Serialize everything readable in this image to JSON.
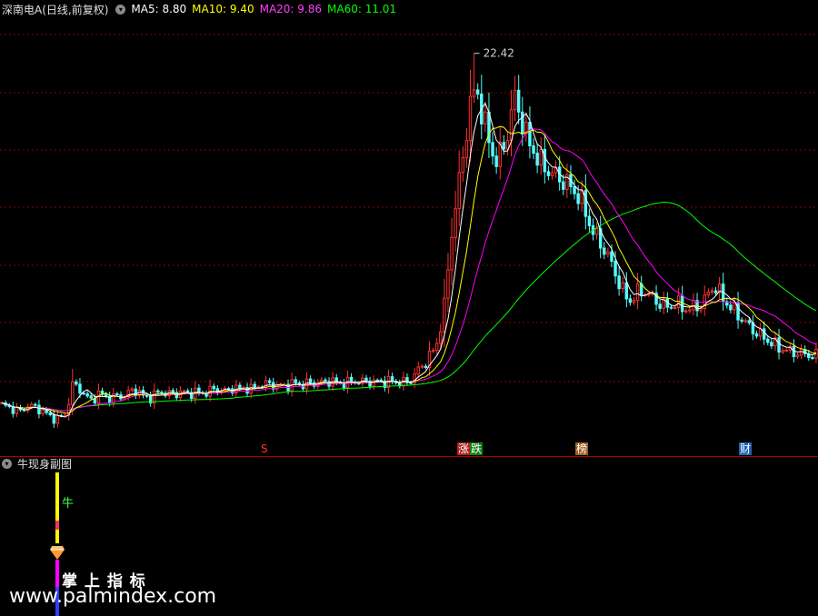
{
  "main_header": {
    "symbol": "深南电A(日线,前复权)",
    "ma5": "MA5: 8.80",
    "ma10": "MA10: 9.40",
    "ma20": "MA20: 9.86",
    "ma60": "MA60: 11.01"
  },
  "sub_header": {
    "title": "牛现身副图"
  },
  "peak_label": "22.42",
  "event_badges": [
    {
      "text": "S",
      "color": "#ff3030"
    },
    {
      "text": "涨",
      "color": "#ff5050"
    },
    {
      "text": "跌",
      "color": "#40e040"
    },
    {
      "text": "榜",
      "color": "#e0a040"
    },
    {
      "text": "财",
      "color": "#40a0ff"
    }
  ],
  "indicator": {
    "bull_label": "牛"
  },
  "watermark": {
    "line1": "掌 上 指 标",
    "line2": "www.palmindex.com"
  },
  "colors": {
    "up": "#ff3030",
    "down": "#54ffff",
    "ma5": "#ffffff",
    "ma10": "#ffff00",
    "ma20": "#ff00ff",
    "ma60": "#00ff00",
    "grid": "#8b0000"
  },
  "chart_data": {
    "type": "candlestick",
    "ylim": [
      5,
      24
    ],
    "peak": 22.42,
    "close_path": [
      6.6,
      6.5,
      6.4,
      6.3,
      6.6,
      6.5,
      6.4,
      6.2,
      6.0,
      6.0,
      6.2,
      7.5,
      7.4,
      7.0,
      6.8,
      7.1,
      7.0,
      6.9,
      7.0,
      7.0,
      7.2,
      7.3,
      7.0,
      6.9,
      7.1,
      7.2,
      7.1,
      7.1,
      7.2,
      7.1,
      7.2,
      7.1,
      7.2,
      7.3,
      7.3,
      7.2,
      7.4,
      7.3,
      7.4,
      7.3,
      7.5,
      7.5,
      7.6,
      7.4,
      7.5,
      7.5,
      7.6,
      7.5,
      7.6,
      7.6,
      7.6,
      7.7,
      7.6,
      7.6,
      7.6,
      7.7,
      7.6,
      7.7,
      7.6,
      7.7,
      7.6,
      7.7,
      7.6,
      7.6,
      7.8,
      8.2,
      8.5,
      8.9,
      9.5,
      11.0,
      14.0,
      16.0,
      18.0,
      20.0,
      21.0,
      19.5,
      18.5,
      17.5,
      18.0,
      19.0,
      20.5,
      19.5,
      18.5,
      18.0,
      17.5,
      17.2,
      17.0,
      16.8,
      16.6,
      16.3,
      16.0,
      15.3,
      14.5,
      14.0,
      13.6,
      13.0,
      12.3,
      11.6,
      11.3,
      11.6,
      11.8,
      11.5,
      11.3,
      11.1,
      11.0,
      11.2,
      11.0,
      10.9,
      11.0,
      11.1,
      11.5,
      12.0,
      11.6,
      11.2,
      10.9,
      10.6,
      10.3,
      10.0,
      9.8,
      9.6,
      9.4,
      9.2,
      9.1,
      9.0,
      8.95,
      8.9,
      8.85,
      8.8
    ],
    "ma60_end": 11.01,
    "ma20_end": 9.86,
    "ma10_end": 9.4,
    "ma5_end": 8.8
  }
}
